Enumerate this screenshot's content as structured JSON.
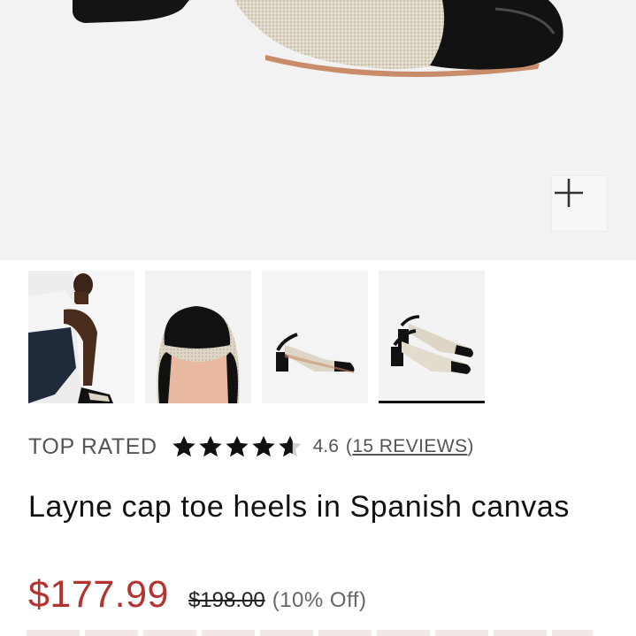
{
  "product": {
    "badge": "TOP RATED",
    "rating": 4.6,
    "rating_text": "4.6",
    "reviews_label": "15 REVIEWS",
    "title": "Layne cap toe heels in Spanish canvas",
    "price": {
      "sale": "$177.99",
      "original": "$198.00",
      "discount": "(10% Off)"
    }
  },
  "gallery": {
    "zoom_icon": "plus-icon",
    "thumbnails": [
      {
        "name": "model-wearing-heels"
      },
      {
        "name": "toe-closeup"
      },
      {
        "name": "side-view-single"
      },
      {
        "name": "pair-view",
        "selected": true
      }
    ]
  },
  "colors": {
    "sale_price": "#b3332f",
    "hero_bg": "#f2f2f2",
    "leather": "#111111",
    "canvas": "#d9d2c2"
  }
}
